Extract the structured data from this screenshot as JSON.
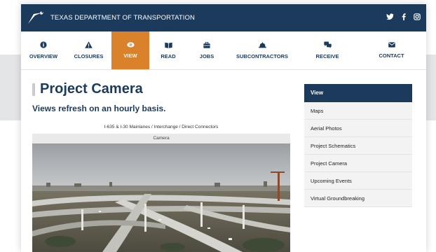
{
  "header": {
    "agency": "TEXAS DEPARTMENT OF TRANSPORTATION",
    "social_icons": [
      "twitter-icon",
      "facebook-icon",
      "instagram-icon"
    ]
  },
  "nav": {
    "items": [
      {
        "label": "OVERVIEW",
        "icon": "info-icon"
      },
      {
        "label": "CLOSURES",
        "icon": "warning-icon"
      },
      {
        "label": "VIEW",
        "icon": "eye-icon",
        "active": true
      },
      {
        "label": "READ",
        "icon": "book-icon"
      },
      {
        "label": "JOBS",
        "icon": "briefcase-icon"
      },
      {
        "label": "SUBCONTRACTORS",
        "icon": "hardhat-icon"
      },
      {
        "label": "RECEIVE",
        "icon": "chat-icon"
      },
      {
        "label": "CONTACT",
        "icon": "envelope-icon"
      }
    ]
  },
  "main": {
    "title": "Project Camera",
    "subtitle": "Views refresh on an hourly basis.",
    "camera_caption": "I-635 & I-30 Mainlanes / Interchange / Direct Connectors",
    "camera_header": "Camera"
  },
  "sidebar": {
    "heading": "View",
    "items": [
      "Maps",
      "Aerial Photos",
      "Project Schematics",
      "Project Camera",
      "Upcoming Events",
      "Virtual Groundbreaking"
    ]
  },
  "colors": {
    "brand_navy": "#1b3a5c",
    "active_orange": "#d9822b"
  }
}
